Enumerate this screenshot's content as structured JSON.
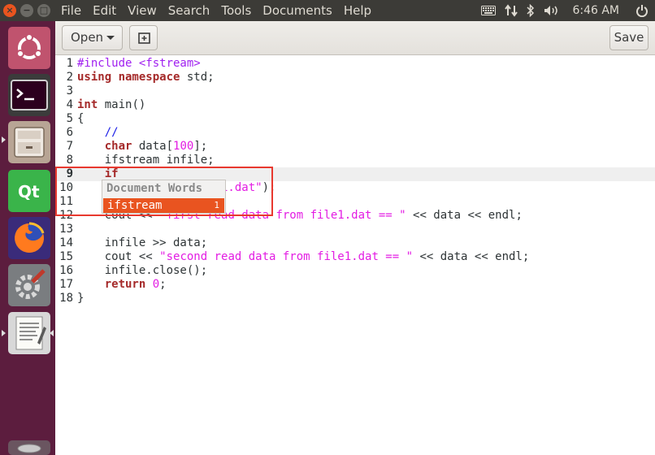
{
  "menubar": [
    "File",
    "Edit",
    "View",
    "Search",
    "Tools",
    "Documents",
    "Help"
  ],
  "window_buttons": {
    "close": "×",
    "minimize": "−",
    "maximize": "□"
  },
  "tray": {
    "clock": "6:46 AM"
  },
  "toolbar": {
    "open_label": "Open",
    "save_label": "Save"
  },
  "editor": {
    "current_line": 9,
    "lines": [
      {
        "n": "1",
        "tokens": [
          {
            "t": "#include <fstream>",
            "c": "pp"
          }
        ]
      },
      {
        "n": "2",
        "tokens": [
          {
            "t": "using namespace",
            "c": "kw"
          },
          {
            "t": " std;",
            "c": ""
          }
        ]
      },
      {
        "n": "3",
        "tokens": []
      },
      {
        "n": "4",
        "tokens": [
          {
            "t": "int",
            "c": "kw"
          },
          {
            "t": " main()",
            "c": ""
          }
        ]
      },
      {
        "n": "5",
        "tokens": [
          {
            "t": "{",
            "c": ""
          }
        ]
      },
      {
        "n": "6",
        "tokens": [
          {
            "t": "    ",
            "c": ""
          },
          {
            "t": "//",
            "c": "cm"
          }
        ]
      },
      {
        "n": "7",
        "tokens": [
          {
            "t": "    ",
            "c": ""
          },
          {
            "t": "char",
            "c": "kw"
          },
          {
            "t": " data[",
            "c": ""
          },
          {
            "t": "100",
            "c": "num"
          },
          {
            "t": "];",
            "c": ""
          }
        ]
      },
      {
        "n": "8",
        "tokens": [
          {
            "t": "    ifstream infile;",
            "c": ""
          }
        ]
      },
      {
        "n": "9",
        "tokens": [
          {
            "t": "    ",
            "c": ""
          },
          {
            "t": "if",
            "c": "kw"
          }
        ]
      },
      {
        "n": "10",
        "tokens": [
          {
            "t": "    infile.open(",
            "c": ""
          },
          {
            "t": "\"file1.dat\"",
            "c": "str"
          },
          {
            "t": ");",
            "c": ""
          }
        ]
      },
      {
        "n": "11",
        "tokens": []
      },
      {
        "n": "12",
        "tokens": [
          {
            "t": "    cout << ",
            "c": ""
          },
          {
            "t": "\"first read data from file1.dat == \"",
            "c": "str"
          },
          {
            "t": " << data << endl;",
            "c": ""
          }
        ]
      },
      {
        "n": "13",
        "tokens": []
      },
      {
        "n": "14",
        "tokens": [
          {
            "t": "    infile >> data;",
            "c": ""
          }
        ]
      },
      {
        "n": "15",
        "tokens": [
          {
            "t": "    cout << ",
            "c": ""
          },
          {
            "t": "\"second read data from file1.dat == \"",
            "c": "str"
          },
          {
            "t": " << data << endl;",
            "c": ""
          }
        ]
      },
      {
        "n": "16",
        "tokens": [
          {
            "t": "    infile.close();",
            "c": ""
          }
        ]
      },
      {
        "n": "17",
        "tokens": [
          {
            "t": "    ",
            "c": ""
          },
          {
            "t": "return",
            "c": "kw"
          },
          {
            "t": " ",
            "c": ""
          },
          {
            "t": "0",
            "c": "num"
          },
          {
            "t": ";",
            "c": ""
          }
        ]
      },
      {
        "n": "18",
        "tokens": [
          {
            "t": "}",
            "c": ""
          }
        ]
      }
    ]
  },
  "completion": {
    "header": "Document Words",
    "items": [
      {
        "word": "ifstream",
        "index": "1"
      }
    ]
  },
  "colors": {
    "accent": "#e95420",
    "launcher_bg": "#5c1d3e",
    "annotation": "#e8392f"
  },
  "launcher_icons": [
    "ubuntu-dash-icon",
    "terminal-icon",
    "files-icon",
    "qt-creator-icon",
    "firefox-icon",
    "system-settings-icon",
    "text-editor-icon",
    "trash-icon"
  ]
}
